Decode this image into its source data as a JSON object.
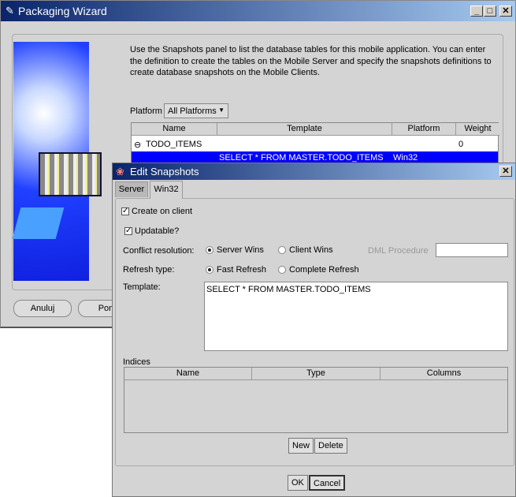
{
  "main_window": {
    "title": "Packaging Wizard",
    "description": "Use the Snapshots panel to list the database tables for this mobile application. You can enter the definition to create the tables on the Mobile Server and specify the snapshots definitions to create database snapshots on the Mobile Clients.",
    "platform_label": "Platform",
    "platform_value": "All Platforms",
    "table": {
      "columns": [
        "Name",
        "Template",
        "Platform",
        "Weight"
      ],
      "rows": [
        {
          "name": "TODO_ITEMS",
          "template": "",
          "platform": "",
          "weight": "0"
        },
        {
          "name": "",
          "template": "SELECT * FROM MASTER.TODO_ITEMS",
          "platform": "Win32",
          "weight": ""
        }
      ]
    },
    "buttons": {
      "cancel": "Anuluj",
      "help": "Pom"
    }
  },
  "dialog": {
    "title": "Edit Snapshots",
    "tabs": [
      "Server",
      "Win32"
    ],
    "active_tab": "Win32",
    "create_on_client": "Create on client",
    "updatable": "Updatable?",
    "conflict_label": "Conflict resolution:",
    "server_wins": "Server Wins",
    "client_wins": "Client Wins",
    "dml_label": "DML Procedure",
    "dml_value": "",
    "refresh_label": "Refresh type:",
    "fast_refresh": "Fast Refresh",
    "complete_refresh": "Complete Refresh",
    "template_label": "Template:",
    "template_value": "SELECT * FROM MASTER.TODO_ITEMS",
    "indices_label": "Indices",
    "indices_columns": [
      "Name",
      "Type",
      "Columns"
    ],
    "new": "New",
    "delete": "Delete",
    "ok": "OK",
    "cancel": "Cancel"
  },
  "colors": {
    "selection": "#0000ff",
    "titlebar": "#0a246a"
  }
}
